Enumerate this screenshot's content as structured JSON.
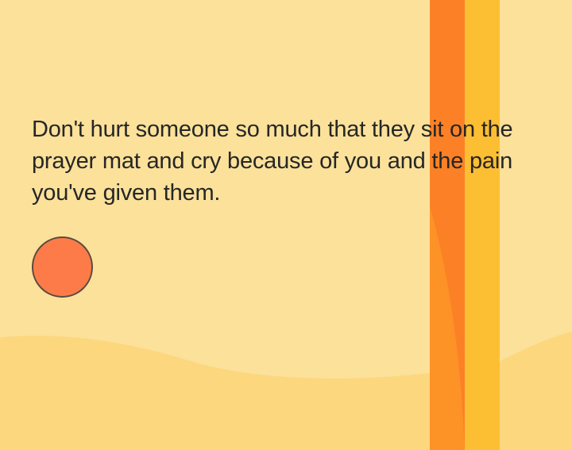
{
  "post": {
    "quote_text": "Don't hurt someone so much that they sit on the prayer mat and cry because of you and the pain you've given them."
  },
  "colors": {
    "background": "#fbe19a",
    "wave": "#fcd77e",
    "stripe_orange": "#fc8126",
    "stripe_yellow": "#fcbe33",
    "accent_dot": "#fd7b48",
    "text": "#262626"
  }
}
